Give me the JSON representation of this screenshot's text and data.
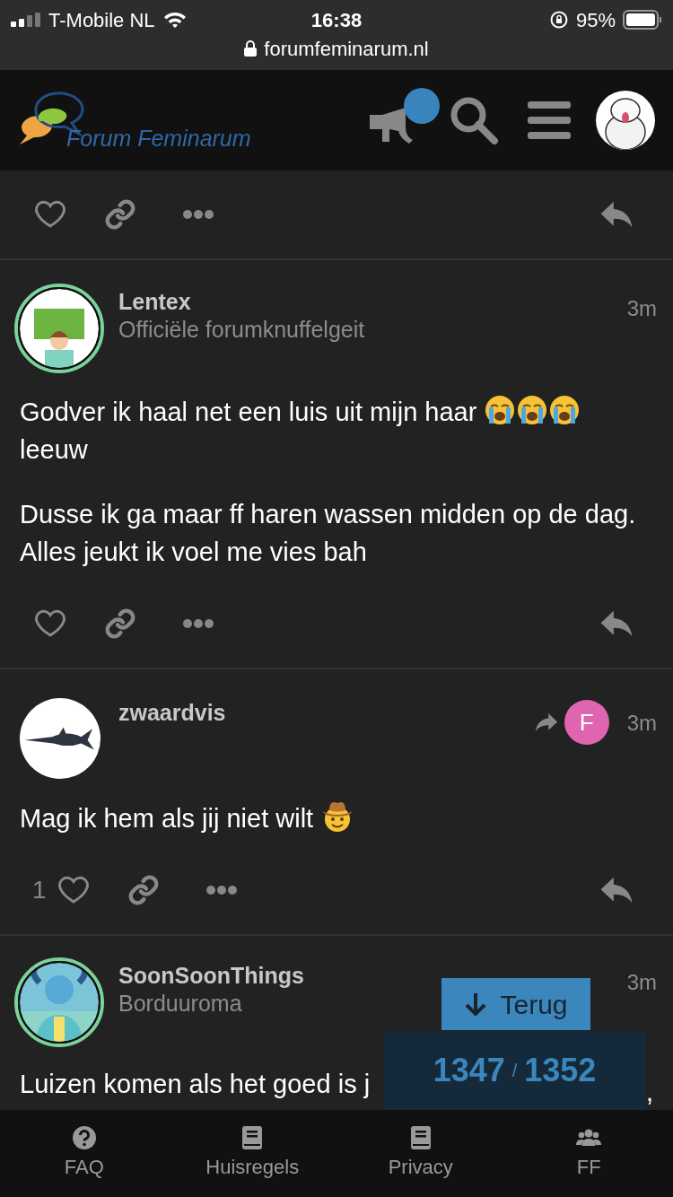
{
  "status_bar": {
    "carrier": "T-Mobile NL",
    "time": "16:38",
    "battery": "95%",
    "url": "forumfeminarum.nl"
  },
  "header": {
    "logo_text": "Forum Feminarum",
    "notification_dot": true
  },
  "posts": [
    {
      "kind": "partial"
    },
    {
      "kind": "full",
      "author": "Lentex",
      "title": "Officiële forumknuffelgeit",
      "time": "3m",
      "flair_ring": true,
      "paragraphs": [
        [
          {
            "kind": "text",
            "text": "Godver ik haal net een luis uit mijn haar "
          },
          {
            "kind": "crying"
          },
          {
            "kind": "crying"
          },
          {
            "kind": "crying"
          },
          {
            "kind": "text",
            "text": " leeuw"
          }
        ],
        [
          {
            "kind": "text",
            "text": "Dusse ik ga maar ff haren wassen midden op de dag. Alles jeukt ik voel me vies bah"
          }
        ]
      ]
    },
    {
      "kind": "full",
      "author": "zwaardvis",
      "time": "3m",
      "flair_ring": false,
      "reply_to": {
        "initial": "F",
        "color": "#e065b0"
      },
      "likes": "1",
      "paragraphs": [
        [
          {
            "kind": "text",
            "text": "Mag ik hem als jij niet wilt "
          },
          {
            "kind": "cowboy"
          }
        ]
      ]
    },
    {
      "kind": "cut",
      "author": "SoonSoonThings",
      "title": "Borduuroma",
      "time": "3m",
      "flair_ring": true,
      "paragraphs": [
        [
          {
            "kind": "text",
            "text": "Luizen komen als het goed is j"
          }
        ]
      ],
      "trailing": ","
    }
  ],
  "back_button": "Terug",
  "progress": {
    "current": "1347",
    "separator": "/",
    "total": "1352"
  },
  "nav": [
    {
      "label": "FAQ",
      "kind": "question"
    },
    {
      "label": "Huisregels",
      "kind": "book"
    },
    {
      "label": "Privacy",
      "kind": "book"
    },
    {
      "label": "FF",
      "kind": "users"
    }
  ]
}
